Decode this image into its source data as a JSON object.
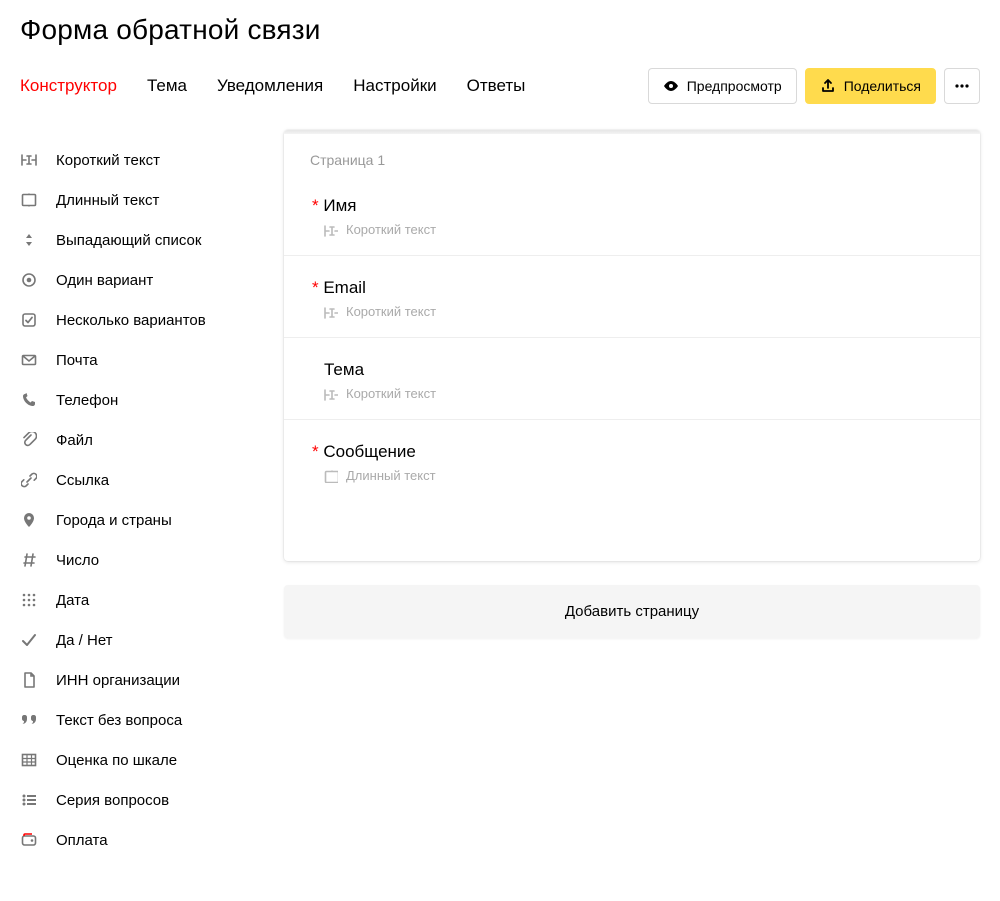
{
  "title": "Форма обратной связи",
  "tabs": {
    "constructor": "Конструктор",
    "theme": "Тема",
    "notify": "Уведомления",
    "settings": "Настройки",
    "answers": "Ответы"
  },
  "actions": {
    "preview": "Предпросмотр",
    "share": "Поделиться"
  },
  "sidebar": {
    "items": [
      {
        "id": "short-text",
        "label": "Короткий текст"
      },
      {
        "id": "long-text",
        "label": "Длинный текст"
      },
      {
        "id": "dropdown",
        "label": "Выпадающий список"
      },
      {
        "id": "single",
        "label": "Один вариант"
      },
      {
        "id": "multi",
        "label": "Несколько вариантов"
      },
      {
        "id": "mail",
        "label": "Почта"
      },
      {
        "id": "phone",
        "label": "Телефон"
      },
      {
        "id": "file",
        "label": "Файл"
      },
      {
        "id": "link",
        "label": "Ссылка"
      },
      {
        "id": "cities",
        "label": "Города и страны"
      },
      {
        "id": "number",
        "label": "Число"
      },
      {
        "id": "date",
        "label": "Дата"
      },
      {
        "id": "yesno",
        "label": "Да / Нет"
      },
      {
        "id": "inn",
        "label": "ИНН организации"
      },
      {
        "id": "text-only",
        "label": "Текст без вопроса"
      },
      {
        "id": "scale",
        "label": "Оценка по шкале"
      },
      {
        "id": "series",
        "label": "Серия вопросов"
      },
      {
        "id": "payment",
        "label": "Оплата"
      }
    ]
  },
  "pageLabel": "Страница 1",
  "questions": [
    {
      "title": "Имя",
      "type": "Короткий текст",
      "typeIcon": "short-text",
      "required": true
    },
    {
      "title": "Email",
      "type": "Короткий текст",
      "typeIcon": "short-text",
      "required": true
    },
    {
      "title": "Тема",
      "type": "Короткий текст",
      "typeIcon": "short-text",
      "required": false
    },
    {
      "title": "Сообщение",
      "type": "Длинный текст",
      "typeIcon": "long-text",
      "required": true
    }
  ],
  "addPage": "Добавить страницу"
}
